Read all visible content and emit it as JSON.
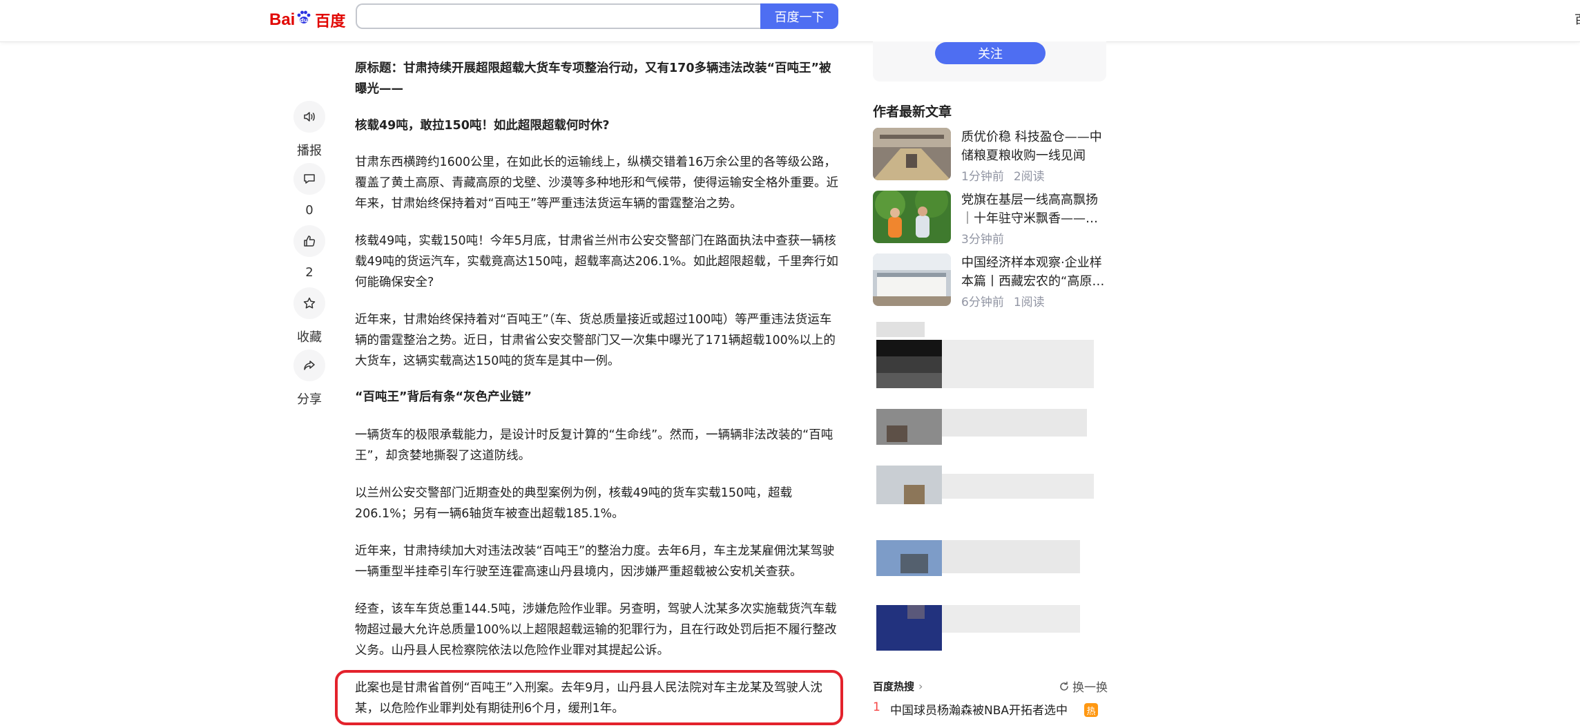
{
  "header": {
    "logo_bai": "Bai",
    "logo_du": "du",
    "logo_cn": "百度",
    "search_value": "",
    "search_button": "百度一下",
    "edge_text": "百"
  },
  "actions": [
    {
      "icon": "speaker-icon",
      "label": "播报"
    },
    {
      "icon": "comment-icon",
      "label": "0"
    },
    {
      "icon": "thumbs-up-icon",
      "label": "2"
    },
    {
      "icon": "star-icon",
      "label": "收藏"
    },
    {
      "icon": "share-icon",
      "label": "分享"
    }
  ],
  "article": {
    "paragraphs": [
      {
        "bold": true,
        "text": "原标题：甘肃持续开展超限超载大货车专项整治行动，又有170多辆违法改装“百吨王”被曝光——"
      },
      {
        "bold": true,
        "text": "核载49吨，敢拉150吨！如此超限超载何时休?"
      },
      {
        "bold": false,
        "text": "甘肃东西横跨约1600公里，在如此长的运输线上，纵横交错着16万余公里的各等级公路，覆盖了黄土高原、青藏高原的戈壁、沙漠等多种地形和气候带，使得运输安全格外重要。近年来，甘肃始终保持着对“百吨王”等严重违法货运车辆的雷霆整治之势。"
      },
      {
        "bold": false,
        "text": "核载49吨，实载150吨！今年5月底，甘肃省兰州市公安交警部门在路面执法中查获一辆核载49吨的货运汽车，实载竟高达150吨，超载率高达206.1%。如此超限超载，千里奔行如何能确保安全?"
      },
      {
        "bold": false,
        "text": "近年来，甘肃始终保持着对“百吨王”（车、货总质量接近或超过100吨）等严重违法货运车辆的雷霆整治之势。近日，甘肃省公安交警部门又一次集中曝光了171辆超载100%以上的大货车，这辆实载高达150吨的货车是其中一例。"
      },
      {
        "bold": true,
        "text": "“百吨王”背后有条“灰色产业链”"
      },
      {
        "bold": false,
        "text": "一辆货车的极限承载能力，是设计时反复计算的“生命线”。然而，一辆辆非法改装的“百吨王”，却贪婪地撕裂了这道防线。"
      },
      {
        "bold": false,
        "text": "以兰州公安交警部门近期查处的典型案例为例，核载49吨的货车实载150吨，超载206.1%；另有一辆6轴货车被查出超载185.1%。"
      },
      {
        "bold": false,
        "text": "近年来，甘肃持续加大对违法改装“百吨王”的整治力度。去年6月，车主龙某雇佣沈某驾驶一辆重型半挂牵引车行驶至连霍高速山丹县境内，因涉嫌严重超载被公安机关查获。"
      },
      {
        "bold": false,
        "text": "经查，该车车货总重144.5吨，涉嫌危险作业罪。另查明，驾驶人沈某多次实施载货汽车载物超过最大允许总质量100%以上超限超载运输的犯罪行为，且在行政处罚后拒不履行整改义务。山丹县人民检察院依法以危险作业罪对其提起公诉。"
      },
      {
        "bold": false,
        "text": "此案也是甘肃省首例“百吨王”入刑案。去年9月，山丹县人民法院对车主龙某及驾驶人沈某，以危险作业罪判处有期徒刑6个月，缓刑1年。"
      }
    ]
  },
  "sidebar": {
    "follow_button": "关注",
    "latest_title": "作者最新文章",
    "latest_articles": [
      {
        "title": "质优价稳 科技盈仓——中储粮夏粮收购一线见闻",
        "time": "1分钟前",
        "reads": "2阅读"
      },
      {
        "title": "党旗在基层一线高高飘扬｜十年驻守米飘香——西藏自治区",
        "time": "3分钟前",
        "reads": ""
      },
      {
        "title": "中国经济样本观察·企业样本篇丨西藏宏农的“高原羊绒”",
        "time": "6分钟前",
        "reads": "1阅读"
      }
    ],
    "hot": {
      "title": "百度热搜",
      "chevron": "›",
      "refresh": "换一换",
      "items": [
        {
          "rank": "1",
          "text": "中国球员杨瀚森被NBA开拓者选中",
          "badge": "热"
        }
      ]
    }
  },
  "colors": {
    "brand_blue": "#4e6ef2",
    "logo_red": "#e10602",
    "highlight_red": "#e3222c",
    "meta_gray": "#9195a3"
  }
}
